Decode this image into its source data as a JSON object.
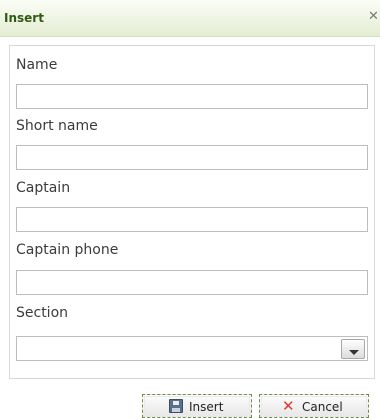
{
  "dialog": {
    "title": "Insert",
    "close_glyph": "✕",
    "close_icon": "close-icon"
  },
  "form": {
    "fields": [
      {
        "label": "Name",
        "value": ""
      },
      {
        "label": "Short name",
        "value": ""
      },
      {
        "label": "Captain",
        "value": ""
      },
      {
        "label": "Captain phone",
        "value": ""
      },
      {
        "label": "Section",
        "value": ""
      }
    ],
    "section_dropdown_icon": "chevron-down-icon"
  },
  "buttons": {
    "insert_label": "Insert",
    "insert_icon": "save-icon",
    "cancel_label": "Cancel",
    "cancel_icon": "x-icon",
    "cancel_glyph": "✕"
  },
  "colors": {
    "title_text": "#2f5b12",
    "titlebar_bg": "#eef4e2",
    "cancel_icon": "#e03a2c",
    "button_focus_border": "#6d8f4a"
  }
}
